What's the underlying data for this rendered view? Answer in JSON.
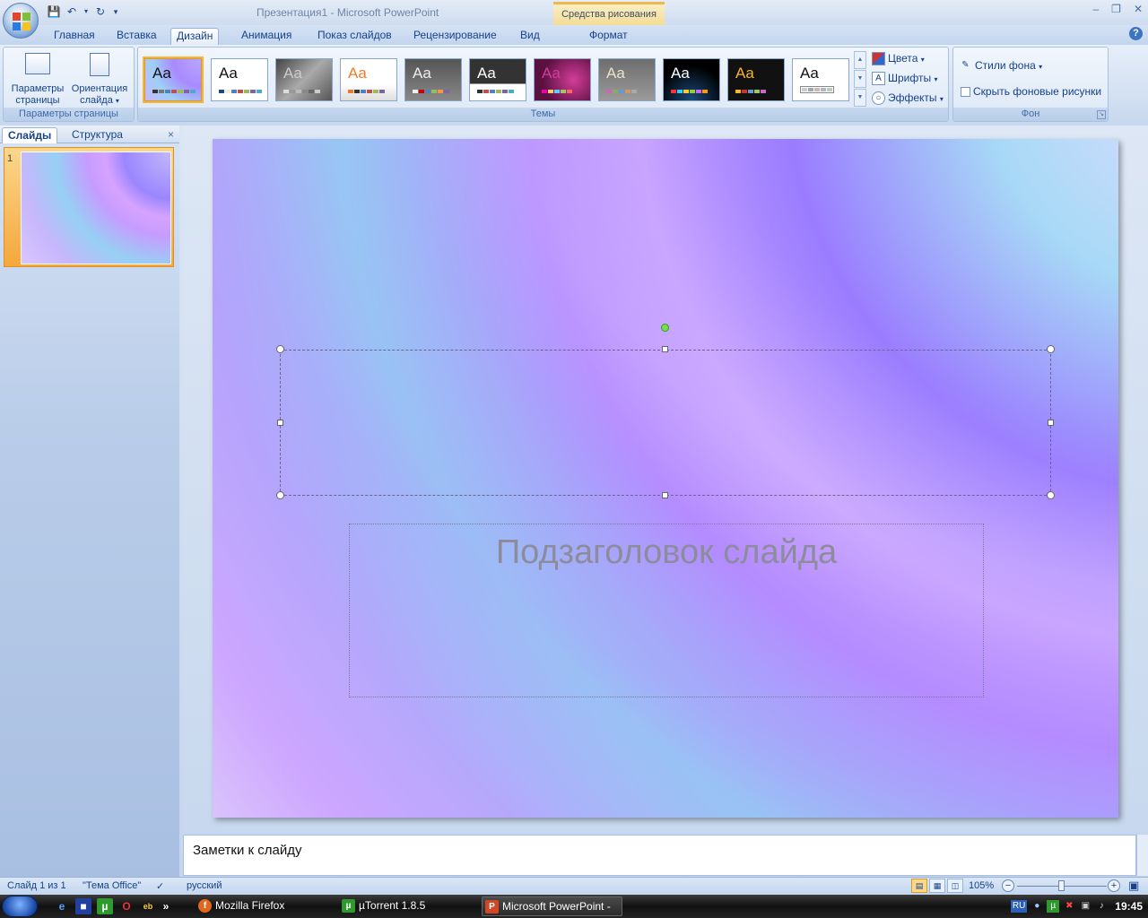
{
  "window": {
    "app_title": "Презентация1 - Microsoft PowerPoint",
    "context_tab_group": "Средства рисования"
  },
  "tabs": [
    {
      "label": "Главная"
    },
    {
      "label": "Вставка"
    },
    {
      "label": "Дизайн",
      "active": true
    },
    {
      "label": "Анимация"
    },
    {
      "label": "Показ слайдов"
    },
    {
      "label": "Рецензирование"
    },
    {
      "label": "Вид"
    },
    {
      "label": "Формат"
    }
  ],
  "ribbon": {
    "page_setup": {
      "btn1_line1": "Параметры",
      "btn1_line2": "страницы",
      "btn2_line1": "Ориентация",
      "btn2_line2": "слайда",
      "group_label": "Параметры страницы"
    },
    "themes": {
      "group_label": "Темы",
      "sample_text": "Aa",
      "options": {
        "colors": "Цвета",
        "fonts": "Шрифты",
        "effects": "Эффекты"
      }
    },
    "background": {
      "group_label": "Фон",
      "styles": "Стили фона",
      "hide_graphics": "Скрыть фоновые рисунки"
    }
  },
  "left_pane": {
    "tab_slides": "Слайды",
    "tab_outline": "Структура",
    "slide_number": "1"
  },
  "slide": {
    "subtitle_placeholder": "Подзаголовок слайда"
  },
  "notes": {
    "placeholder": "Заметки к слайду"
  },
  "status": {
    "slide_counter": "Слайд 1 из 1",
    "theme": "\"Тема Office\"",
    "language": "русский",
    "zoom": "105%"
  },
  "taskbar": {
    "tasks": [
      {
        "label": "Mozilla Firefox"
      },
      {
        "label": "µTorrent 1.8.5"
      },
      {
        "label": "Microsoft PowerPoint - [..."
      }
    ],
    "lang": "RU",
    "clock": "19:45"
  },
  "colors": {
    "accent": "#15428b",
    "ribbon": "#dde8f6",
    "selected": "#f2b542"
  }
}
